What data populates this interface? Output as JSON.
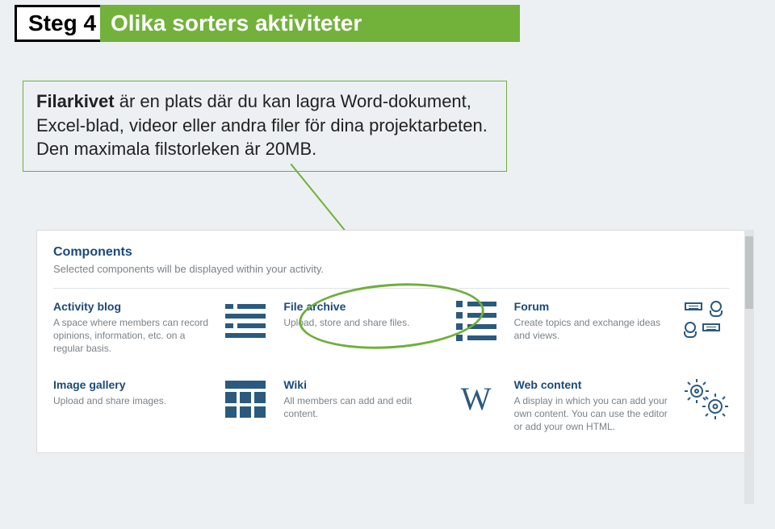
{
  "step": {
    "label": "Steg 4",
    "title": "Olika sorters aktiviteter"
  },
  "callout": {
    "bold": "Filarkivet",
    "rest": " är en plats där du kan lagra Word-dokument, Excel-blad, videor eller andra filer för dina projektarbeten. Den maximala filstorleken är 20MB."
  },
  "panel": {
    "heading": "Components",
    "subtitle": "Selected components will be displayed within your activity."
  },
  "tiles": [
    {
      "title": "Activity blog",
      "desc": "A space where members can record opinions, information, etc. on a regular basis."
    },
    {
      "title": "File archive",
      "desc": "Upload, store and share files."
    },
    {
      "title": "Forum",
      "desc": "Create topics and exchange ideas and views."
    },
    {
      "title": "Image gallery",
      "desc": "Upload and share images."
    },
    {
      "title": "Wiki",
      "desc": "All members can add and edit content."
    },
    {
      "title": "Web content",
      "desc": "A display in which you can add your own content. You can use the editor or add your own HTML."
    }
  ]
}
